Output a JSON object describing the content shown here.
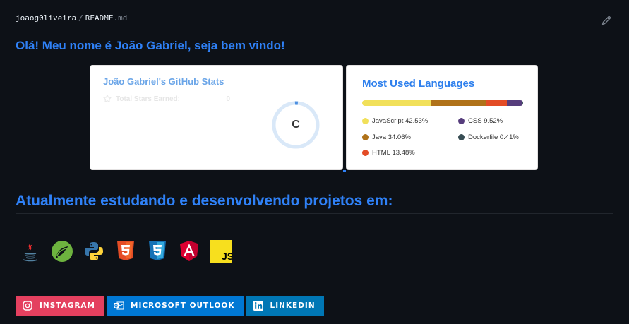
{
  "breadcrumb": {
    "owner": "joaog0liveira",
    "separator": "/",
    "file": "README",
    "extension": ".md"
  },
  "readme": {
    "greeting": "Olá! Meu nome é João Gabriel, seja bem vindo!",
    "studying_heading": "Atualmente estudando e desenvolvendo projetos em:"
  },
  "stats_card": {
    "title": "João Gabriel's GitHub Stats",
    "stars_label": "Total Stars Earned:",
    "stars_value": "0",
    "rank": "C"
  },
  "languages_card": {
    "title": "Most Used Languages",
    "languages": [
      {
        "name": "JavaScript",
        "percent": "42.53%",
        "value": 42.53,
        "color": "#f1e05a"
      },
      {
        "name": "Java",
        "percent": "34.06%",
        "value": 34.06,
        "color": "#b07219"
      },
      {
        "name": "HTML",
        "percent": "13.48%",
        "value": 13.48,
        "color": "#e34c26"
      },
      {
        "name": "CSS",
        "percent": "9.52%",
        "value": 9.52,
        "color": "#563d7c"
      },
      {
        "name": "Dockerfile",
        "percent": "0.41%",
        "value": 0.41,
        "color": "#384d54"
      }
    ]
  },
  "tech_icons": [
    "java-icon",
    "spring-icon",
    "python-icon",
    "html5-icon",
    "css3-icon",
    "angular-icon",
    "javascript-icon"
  ],
  "tech_labels": {
    "javascript": "JS"
  },
  "badges": [
    {
      "label": "INSTAGRAM",
      "color": "#e4405f",
      "icon": "instagram-icon"
    },
    {
      "label": "MICROSOFT OUTLOOK",
      "color": "#0078d4",
      "icon": "outlook-icon"
    },
    {
      "label": "LINKEDIN",
      "color": "#0077b5",
      "icon": "linkedin-icon"
    }
  ]
}
